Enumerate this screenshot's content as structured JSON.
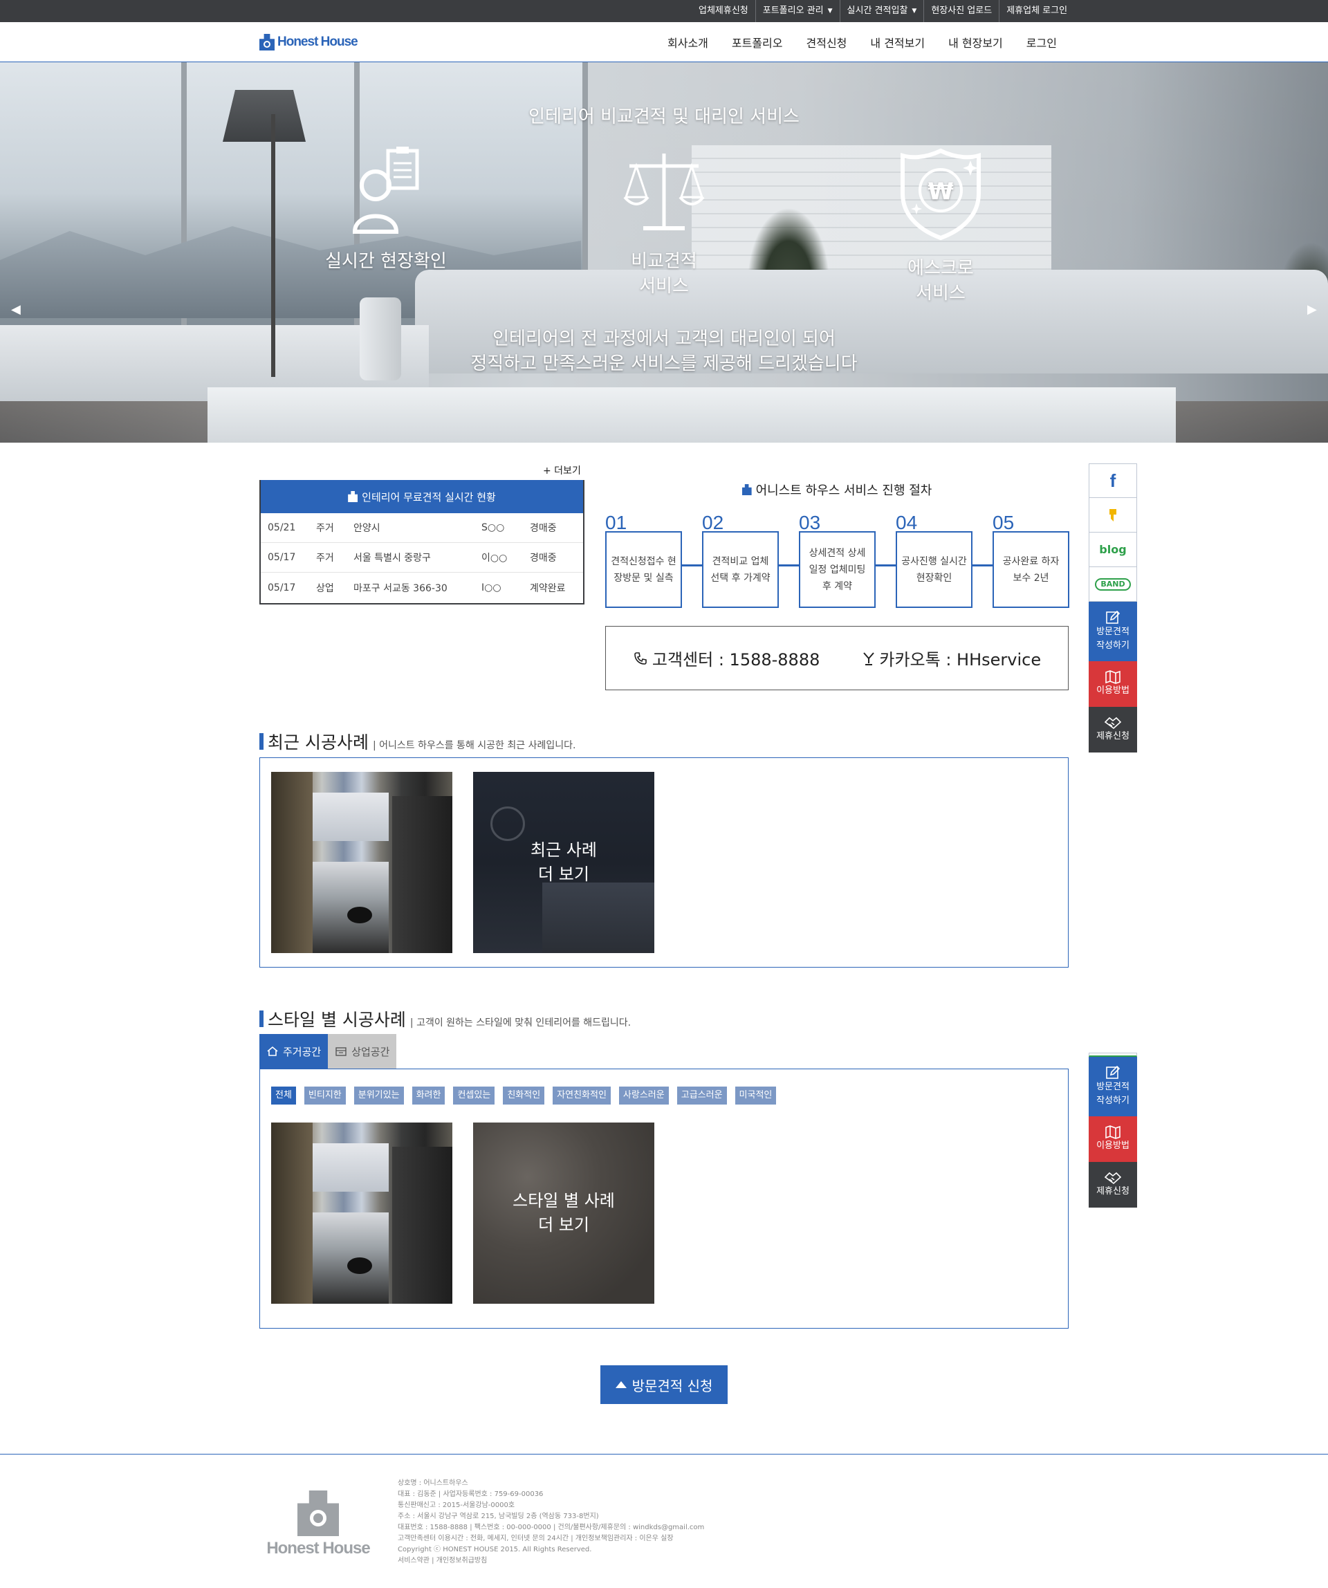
{
  "topbar": {
    "items": [
      {
        "label": "업체제휴신청",
        "caret": false
      },
      {
        "label": "포트폴리오 관리",
        "caret": true
      },
      {
        "label": "실시간 견적입찰",
        "caret": true
      },
      {
        "label": "현장사진 업로드",
        "caret": false
      },
      {
        "label": "제휴업체 로그인",
        "caret": false
      }
    ]
  },
  "brand": {
    "name": "Honest House",
    "color": "#2b64b8"
  },
  "menu": [
    "회사소개",
    "포트폴리오",
    "견적신청",
    "내 견적보기",
    "내 현장보기",
    "로그인"
  ],
  "hero": {
    "title": "인테리어 비교견적 및 대리인 서비스",
    "features": [
      {
        "icon": "clipboard-person-icon",
        "line1": "실시간 현장확인",
        "line2": ""
      },
      {
        "icon": "scale-icon",
        "line1": "비교견적",
        "line2": "서비스"
      },
      {
        "icon": "won-shield-icon",
        "line1": "에스크로",
        "line2": "서비스"
      }
    ],
    "subtitle_line1": "인테리어의 전 과정에서 고객의 대리인이 되어",
    "subtitle_line2": "정직하고 만족스러운 서비스를 제공해 드리겠습니다"
  },
  "realtime": {
    "more_label": "+ 더보기",
    "title": "인테리어 무료견적 실시간 현황",
    "rows": [
      {
        "date": "05/21",
        "type": "주거",
        "address": "안양시",
        "name": "S○○",
        "status": "경매중"
      },
      {
        "date": "05/17",
        "type": "주거",
        "address": "서울 특별시 중랑구",
        "name": "이○○",
        "status": "경매중"
      },
      {
        "date": "05/17",
        "type": "상업",
        "address": "마포구 서교동 366-30",
        "name": "I○○",
        "status": "계약완료"
      }
    ]
  },
  "process": {
    "title": "어니스트 하우스 서비스 진행 절차",
    "steps": [
      {
        "num": "01",
        "text": "견적신청접수 현장방문 및 실측"
      },
      {
        "num": "02",
        "text": "견적비교 업체 선택 후 가계약"
      },
      {
        "num": "03",
        "text": "상세견적 상세 일정 업체미팅 후 계약"
      },
      {
        "num": "04",
        "text": "공사진행 실시간 현장확인"
      },
      {
        "num": "05",
        "text": "공사완료 하자 보수 2년"
      }
    ]
  },
  "contact": {
    "phone_label": "고객센터 : 1588-8888",
    "kakao_label": "카카오톡 : HHservice"
  },
  "recent": {
    "title": "최근 시공사례",
    "desc": "| 어니스트 하우스를 통해 시공한 최근 사례입니다.",
    "more_line1": "최근 사례",
    "more_line2": "더 보기"
  },
  "style": {
    "title": "스타일 별 시공사례",
    "desc": "| 고객이 원하는 스타일에 맞춰 인테리어를 해드립니다.",
    "tabs": [
      {
        "label": "주거공간",
        "icon": "home-icon",
        "active": true
      },
      {
        "label": "상업공간",
        "icon": "shop-icon",
        "active": false
      }
    ],
    "tags": [
      "전체",
      "빈티지한",
      "분위기있는",
      "화려한",
      "컨셉있는",
      "친화적인",
      "자연친화적인",
      "사랑스러운",
      "고급스러운",
      "미국적인"
    ],
    "active_tag": "전체",
    "more_line1": "스타일 별 사례",
    "more_line2": "더 보기"
  },
  "cta": {
    "label": "방문견적 신청"
  },
  "sidebar": {
    "social": [
      "f",
      "blog",
      "BAND"
    ],
    "visit_label_1": "방문견적",
    "visit_label_2": "작성하기",
    "guide_label": "이용방법",
    "partner_label": "제휴신청"
  },
  "footer": {
    "logo_text": "Honest House",
    "lines": [
      "상호명 : 어니스트하우스",
      "대표 : 김동준 | 사업자등록번호 : 759-69-00036",
      "통신판매신고 : 2015-서울강남-0000호",
      "주소 : 서울시 강남구 역삼로 215, 남국빌딩 2층 (역삼동 733-8번지)",
      "대표번호 : 1588-8888 | 팩스번호 : 00-000-0000 | 건의/불편사항/제휴문의 : windkds@gmail.com",
      "고객만족센터 이용시간 : 전화, 메세지, 인터넷 문의 24시간 | 개인정보책임관리자 : 이은우 실장",
      "Copyright ⓒ HONEST HOUSE 2015. All Rights Reserved.",
      "서비스약관 | 개인정보취급방침"
    ]
  }
}
